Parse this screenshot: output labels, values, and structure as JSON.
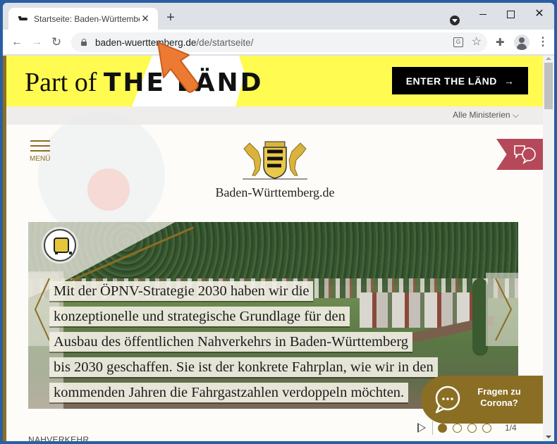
{
  "browser": {
    "tab_title": "Startseite: Baden-Württemberg.de",
    "tab_close": "✕",
    "new_tab": "+",
    "url_domain": "baden-wuerttemberg.de",
    "url_path": "/de/startseite/",
    "nav": {
      "back": "←",
      "forward": "→",
      "reload": "↻"
    },
    "icons": {
      "translate": "G",
      "star": "☆",
      "extensions": "✚",
      "menu": "⋮",
      "close": "✕"
    }
  },
  "banner": {
    "part_of": "Part of ",
    "the_land": "THE LÄND",
    "enter_button": "ENTER THE LÄND",
    "enter_arrow": "→",
    "accent_color": "#fffb50"
  },
  "ministerien": {
    "label": "Alle Ministerien",
    "chevron": "⌵"
  },
  "header": {
    "menu_label": "MENÜ",
    "site_name": "Baden-Württemberg.de"
  },
  "slider": {
    "caption_lines": [
      "Mit der ÖPNV-Strategie 2030 haben wir die",
      "konzeptionelle und strategische Grundlage für den",
      "Ausbau des öffentlichen Nahverkehrs in Baden-Württemberg",
      "bis 2030 geschaffen. Sie ist der konkrete Fahrplan, wie wir in den",
      "kommenden Jahren die Fahrgastzahlen verdoppeln möchten."
    ],
    "current_slide": 1,
    "total_slides": 4,
    "counter": "1/4",
    "category": "NAHVERKEHR"
  },
  "corona": {
    "line1": "Fragen zu",
    "line2": "Corona?"
  },
  "colors": {
    "gold": "#8a6e23",
    "chat_red": "#b5495a",
    "black": "#000000"
  }
}
